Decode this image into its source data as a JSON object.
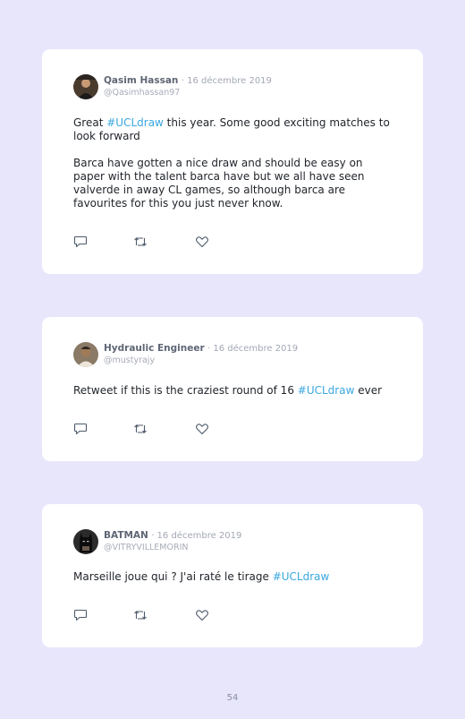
{
  "tweets": [
    {
      "name": "Qasim Hassan",
      "date": "· 16 décembre 2019",
      "handle": "@Qasimhassan97",
      "avatar_icon": "profile-photo",
      "paragraphs": [
        {
          "before": "Great ",
          "tag": "#UCLdraw",
          "after": " this year. Some good exciting matches to look forward"
        },
        {
          "before": "Barca have gotten a nice draw and should be easy on paper with the talent barca have but we all have seen valverde in away CL games, so although barca are favourites for this you just never know.",
          "tag": "",
          "after": ""
        }
      ]
    },
    {
      "name": "Hydraulic Engineer",
      "date": "· 16 décembre 2019",
      "handle": "@mustyrajy",
      "avatar_icon": "profile-photo",
      "paragraphs": [
        {
          "before": "Retweet if this is the craziest round of 16 ",
          "tag": "#UCLdraw",
          "after": " ever"
        }
      ]
    },
    {
      "name": "BATMAN",
      "date": "· 16 décembre 2019",
      "handle": "@VITRYVILLEMORIN",
      "avatar_icon": "batman-avatar",
      "paragraphs": [
        {
          "before": "Marseille joue qui ? J'ai raté le tirage ",
          "tag": "#UCLdraw",
          "after": ""
        }
      ]
    }
  ],
  "actions": {
    "reply_icon": "reply-icon",
    "retweet_icon": "retweet-icon",
    "like_icon": "heart-icon"
  },
  "colors": {
    "background": "#e8e6fb",
    "card": "#ffffff",
    "hashtag": "#39a7e0",
    "name": "#5f6675",
    "muted": "#a3a8b4"
  },
  "page_number": "54"
}
